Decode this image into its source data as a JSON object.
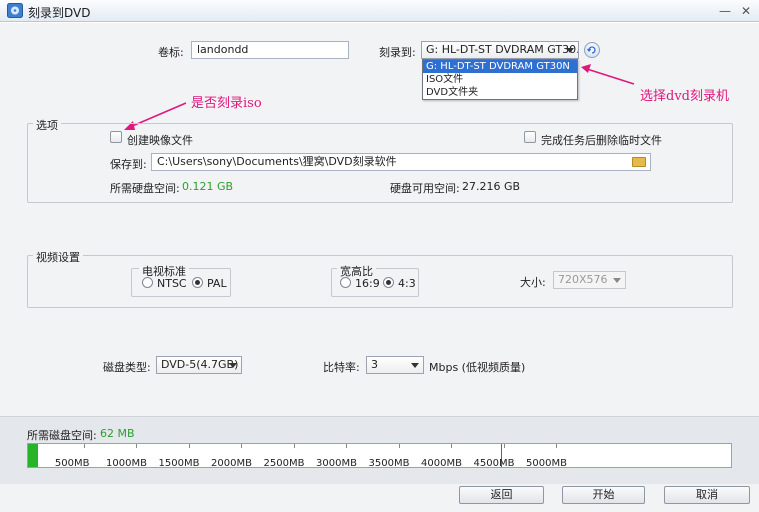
{
  "window": {
    "title": "刻录到DVD",
    "minimize_glyph": "—",
    "close_glyph": "✕"
  },
  "top": {
    "volume_label": "卷标:",
    "volume_value": "landondd",
    "burn_to_label": "刻录到:",
    "burn_to_value": "G: HL-DT-ST DVDRAM GT30...",
    "refresh_icon": "refresh-icon"
  },
  "burn_dropdown": {
    "options": [
      "G: HL-DT-ST DVDRAM GT30N",
      "ISO文件",
      "DVD文件夹"
    ],
    "selected_index": 0
  },
  "annotations": {
    "iso_question": "是否刻录iso",
    "select_burner": "选择dvd刻录机",
    "color": "#e0177c"
  },
  "options_group": {
    "title": "选项",
    "create_image_label": "创建映像文件",
    "delete_temp_label": "完成任务后删除临时文件",
    "save_to_label": "保存到:",
    "save_to_path": "C:\\Users\\sony\\Documents\\狸窝\\DVD刻录软件",
    "folder_icon": "folder-icon",
    "required_space_label": "所需硬盘空间:",
    "required_space_value": "0.121 GB",
    "available_space_label": "硬盘可用空间:",
    "available_space_value": "27.216 GB"
  },
  "video_group": {
    "title": "视频设置",
    "tv_standard_title": "电视标准",
    "ntsc_label": "NTSC",
    "pal_label": "PAL",
    "tv_selected": "PAL",
    "aspect_title": "宽高比",
    "aspect_169_label": "16:9",
    "aspect_43_label": "4:3",
    "aspect_selected": "4:3",
    "size_label": "大小:",
    "size_value": "720X576"
  },
  "disc": {
    "type_label": "磁盘类型:",
    "type_value": "DVD-5(4.7GB)",
    "bitrate_label": "比特率:",
    "bitrate_value": "3",
    "bitrate_unit": "Mbps (低视频质量)"
  },
  "space_bar": {
    "label": "所需磁盘空间:",
    "value": "62 MB",
    "ticks": [
      "500MB",
      "1000MB",
      "1500MB",
      "2000MB",
      "2500MB",
      "3000MB",
      "3500MB",
      "4000MB",
      "4500MB",
      "5000MB"
    ],
    "fill_mb": 62,
    "capacity_marker_mb": 4480,
    "fill_color": "#28b428",
    "marker_color": "#e03030"
  },
  "buttons": {
    "back": "返回",
    "start": "开始",
    "cancel": "取消"
  },
  "colors": {
    "accent": "#2f6fd1",
    "green": "#2e9e2e"
  }
}
